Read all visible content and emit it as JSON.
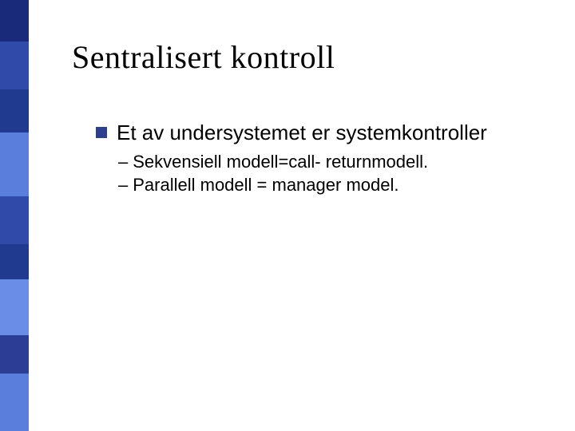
{
  "title": "Sentralisert kontroll",
  "bullets": {
    "main": "Et av undersystemet er systemkontroller",
    "sub1": "Sekvensiell modell=call- returnmodell.",
    "sub2": "Parallell modell = manager model."
  },
  "sidebar_colors": [
    {
      "color": "#1a2a7a",
      "h": 52
    },
    {
      "color": "#2f4aa8",
      "h": 60
    },
    {
      "color": "#203a90",
      "h": 54
    },
    {
      "color": "#5a7edc",
      "h": 80
    },
    {
      "color": "#2f4aa8",
      "h": 60
    },
    {
      "color": "#203a90",
      "h": 44
    },
    {
      "color": "#6a8ee8",
      "h": 70
    },
    {
      "color": "#2b3d95",
      "h": 48
    },
    {
      "color": "#5a7edc",
      "h": 72
    }
  ]
}
